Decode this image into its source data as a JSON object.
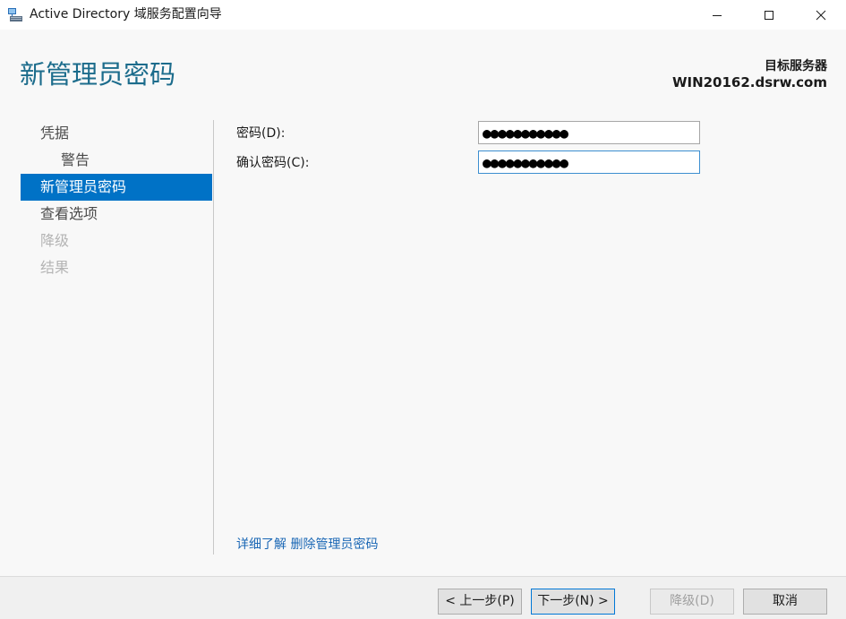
{
  "window": {
    "title": "Active Directory 域服务配置向导",
    "icon": "server-ad-icon",
    "controls": [
      "minimize-icon",
      "maximize-icon",
      "close-icon"
    ]
  },
  "header": {
    "page_title": "新管理员密码",
    "target_label": "目标服务器",
    "target_name": "WIN20162.dsrw.com"
  },
  "nav": {
    "items": [
      {
        "label": "凭据",
        "state": "normal"
      },
      {
        "label": "警告",
        "state": "sub"
      },
      {
        "label": "新管理员密码",
        "state": "active"
      },
      {
        "label": "查看选项",
        "state": "normal"
      },
      {
        "label": "降级",
        "state": "disabled"
      },
      {
        "label": "结果",
        "state": "disabled"
      }
    ]
  },
  "form": {
    "password_label": "密码(D):",
    "password_value": "●●●●●●●●●●●",
    "confirm_label": "确认密码(C):",
    "confirm_value": "●●●●●●●●●●●"
  },
  "help_link": "详细了解 删除管理员密码",
  "footer": {
    "prev_label": "< 上一步(P)",
    "next_label": "下一步(N) >",
    "demote_label": "降级(D)",
    "cancel_label": "取消"
  },
  "colors": {
    "accent": "#0072c6",
    "title": "#1c6c8c",
    "link": "#1a67b5"
  }
}
